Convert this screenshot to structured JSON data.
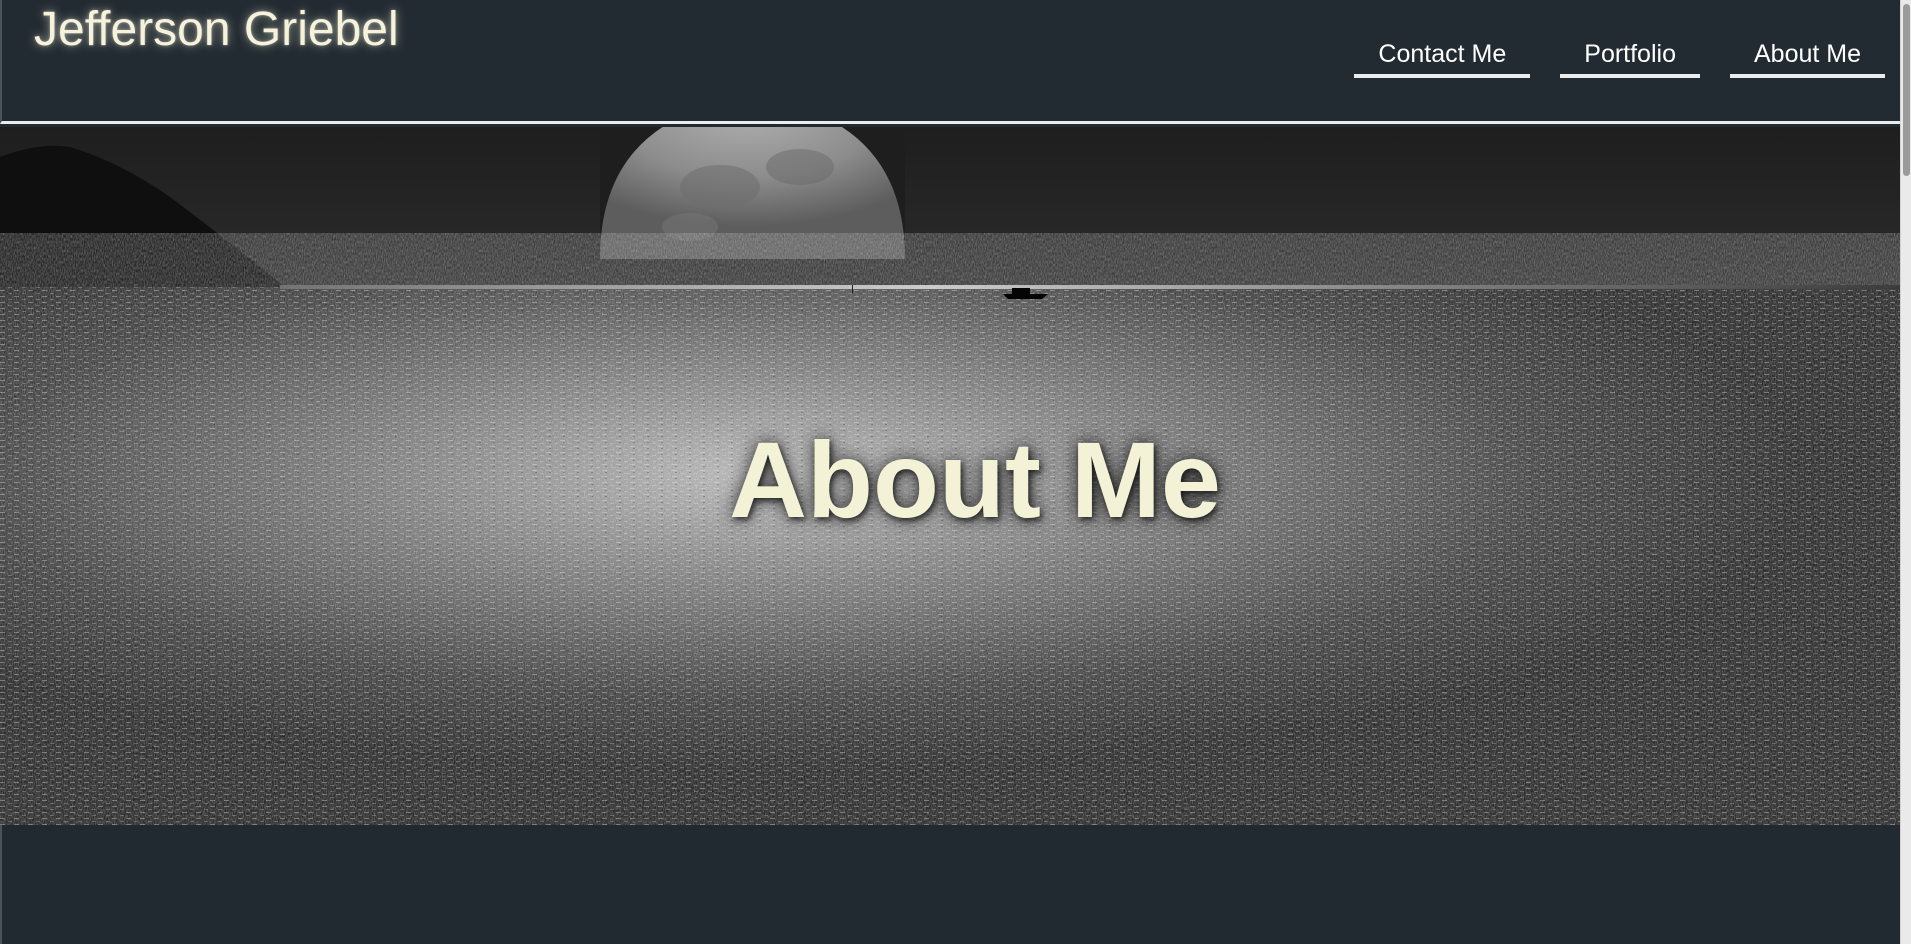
{
  "header": {
    "site_title": "Jefferson Griebel",
    "nav": [
      {
        "label": "Contact Me"
      },
      {
        "label": "Portfolio"
      },
      {
        "label": "About Me"
      }
    ]
  },
  "hero": {
    "title": "About Me",
    "image": "moonlit-sea-photo"
  },
  "colors": {
    "background": "#222a31",
    "title_text": "#f3f2d6",
    "nav_underline": "#ececec"
  }
}
